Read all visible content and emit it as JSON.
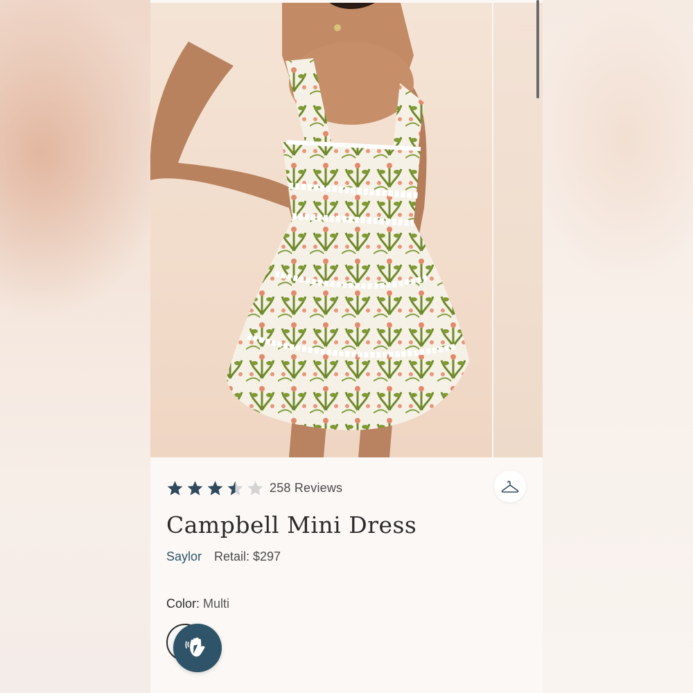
{
  "product": {
    "rating": 3.5,
    "rating_max": 5,
    "reviews_label": "258 Reviews",
    "title": "Campbell Mini Dress",
    "brand": "Saylor",
    "retail": "Retail: $297",
    "color_label": "Color:",
    "color_value": "Multi"
  },
  "icons": {
    "hanger": "hanger-icon",
    "wave": "wave-hand-icon",
    "star": "star-icon"
  },
  "colors": {
    "star_filled": "#2f4a5c",
    "star_empty": "#d3d3d3",
    "brand_link": "#2f5368",
    "accent_button": "#2f5368"
  }
}
